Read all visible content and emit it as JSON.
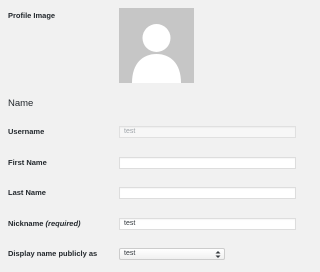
{
  "profile": {
    "image_label": "Profile Image"
  },
  "name_section": {
    "title": "Name",
    "username": {
      "label": "Username",
      "value": "test"
    },
    "first_name": {
      "label": "First Name",
      "value": ""
    },
    "last_name": {
      "label": "Last Name",
      "value": ""
    },
    "nickname": {
      "label": "Nickname",
      "required_note": "(required)",
      "value": "test"
    },
    "display_name": {
      "label": "Display name publicly as",
      "selected": "test"
    }
  },
  "icons": {
    "avatar": "default-avatar-icon",
    "select_arrow": "up-down-chevron-icon"
  },
  "colors": {
    "page_bg": "#f1f1f1",
    "avatar_bg": "#c6c6c6",
    "avatar_fg": "#ffffff",
    "text": "#23282d"
  }
}
